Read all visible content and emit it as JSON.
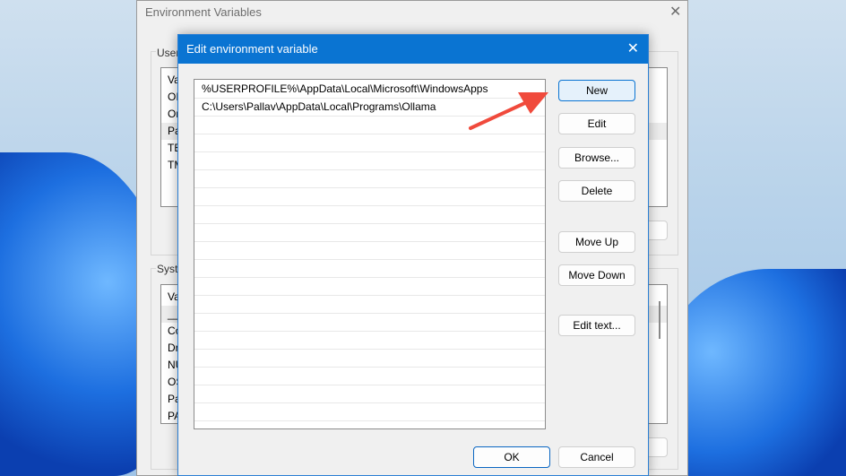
{
  "parent_window": {
    "title": "Environment Variables",
    "close": "✕",
    "user_group_label": "User",
    "user_list_header": "Va",
    "user_rows": [
      "OI",
      "Or",
      "Pa",
      "TE",
      "TM"
    ],
    "system_group_label": "Syste",
    "system_list_header": "Va",
    "system_rows": [
      "__",
      "Co",
      "Dr",
      "NU",
      "OS",
      "Pa",
      "PA"
    ]
  },
  "dialog": {
    "title": "Edit environment variable",
    "close": "✕",
    "entries": [
      "%USERPROFILE%\\AppData\\Local\\Microsoft\\WindowsApps",
      "C:\\Users\\Pallav\\AppData\\Local\\Programs\\Ollama"
    ],
    "buttons": {
      "new": "New",
      "edit": "Edit",
      "browse": "Browse...",
      "delete": "Delete",
      "move_up": "Move Up",
      "move_down": "Move Down",
      "edit_text": "Edit text...",
      "ok": "OK",
      "cancel": "Cancel"
    }
  },
  "colors": {
    "titlebar": "#0a74d2",
    "arrow": "#f04a3c"
  }
}
